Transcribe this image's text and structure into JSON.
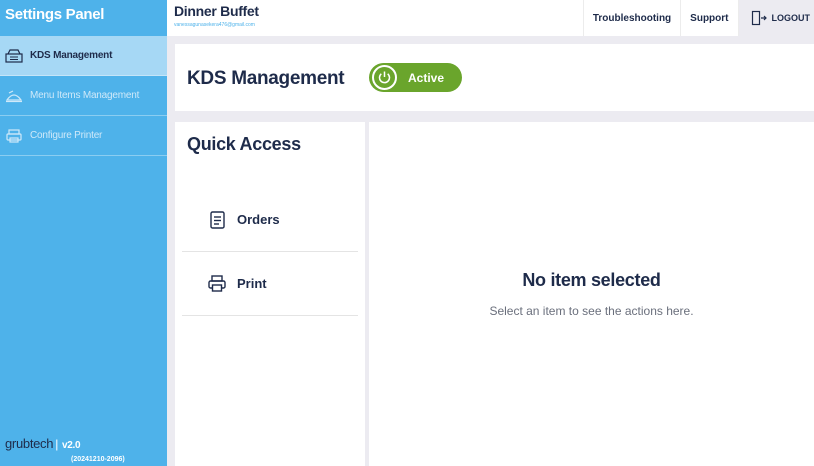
{
  "sidebar": {
    "title": "Settings Panel",
    "items": [
      {
        "label": "KDS Management",
        "icon": "kitchen-icon",
        "active": true
      },
      {
        "label": "Menu Items Management",
        "icon": "menu-tray-icon",
        "active": false
      },
      {
        "label": "Configure Printer",
        "icon": "printer-icon",
        "active": false
      }
    ],
    "footer": {
      "brand": "grubtech",
      "separator": "|",
      "version": "v2.0",
      "build": "(20241210-2096)"
    }
  },
  "topbar": {
    "venue_name": "Dinner Buffet",
    "email": "vanessagunasekera476@gmail.com",
    "nav": {
      "troubleshooting": "Troubleshooting",
      "support": "Support",
      "logout": "LOGOUT"
    }
  },
  "header": {
    "title": "KDS Management",
    "status_label": "Active",
    "status_on": true
  },
  "quick_access": {
    "title": "Quick Access",
    "items": [
      {
        "label": "Orders",
        "icon": "orders-document-icon"
      },
      {
        "label": "Print",
        "icon": "printer-icon"
      }
    ]
  },
  "detail": {
    "empty_title": "No item selected",
    "empty_subtitle": "Select an item to see the actions here."
  },
  "colors": {
    "sidebar_bg": "#4eb2ea",
    "sidebar_active": "#a6d8f5",
    "accent_green": "#6aa52c",
    "text_dark": "#1e2b4a",
    "page_bg": "#ecebf1"
  }
}
